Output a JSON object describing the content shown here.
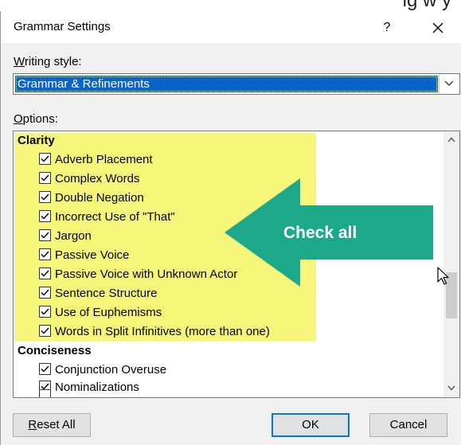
{
  "background": {
    "partial_text": "ig w y"
  },
  "dialog": {
    "title": "Grammar Settings",
    "help_label": "?",
    "close_label": "✕",
    "writing_style_label_accel": "W",
    "writing_style_label_rest": "riting style:",
    "writing_style_value": "Grammar & Refinements",
    "options_label_accel": "O",
    "options_label_rest": "ptions:",
    "groups": [
      {
        "name": "Clarity",
        "items": [
          {
            "label": "Adverb Placement",
            "checked": true
          },
          {
            "label": "Complex Words",
            "checked": true
          },
          {
            "label": "Double Negation",
            "checked": true
          },
          {
            "label": "Incorrect Use of \"That\"",
            "checked": true
          },
          {
            "label": "Jargon",
            "checked": true
          },
          {
            "label": "Passive Voice",
            "checked": true
          },
          {
            "label": "Passive Voice with Unknown Actor",
            "checked": true
          },
          {
            "label": "Sentence Structure",
            "checked": true
          },
          {
            "label": "Use of Euphemisms",
            "checked": true
          },
          {
            "label": "Words in Split Infinitives (more than one)",
            "checked": true
          }
        ]
      },
      {
        "name": "Conciseness",
        "items": [
          {
            "label": "Conjunction Overuse",
            "checked": true
          },
          {
            "label": "Nominalizations",
            "checked": true
          }
        ]
      }
    ],
    "callout_text": "Check all",
    "buttons": {
      "reset_accel": "R",
      "reset_rest": "eset All",
      "ok": "OK",
      "cancel": "Cancel"
    }
  },
  "colors": {
    "selection": "#0a63c8",
    "highlight": "#f6f77a",
    "callout": "#1ea88a",
    "ok_border": "#0078d7"
  }
}
